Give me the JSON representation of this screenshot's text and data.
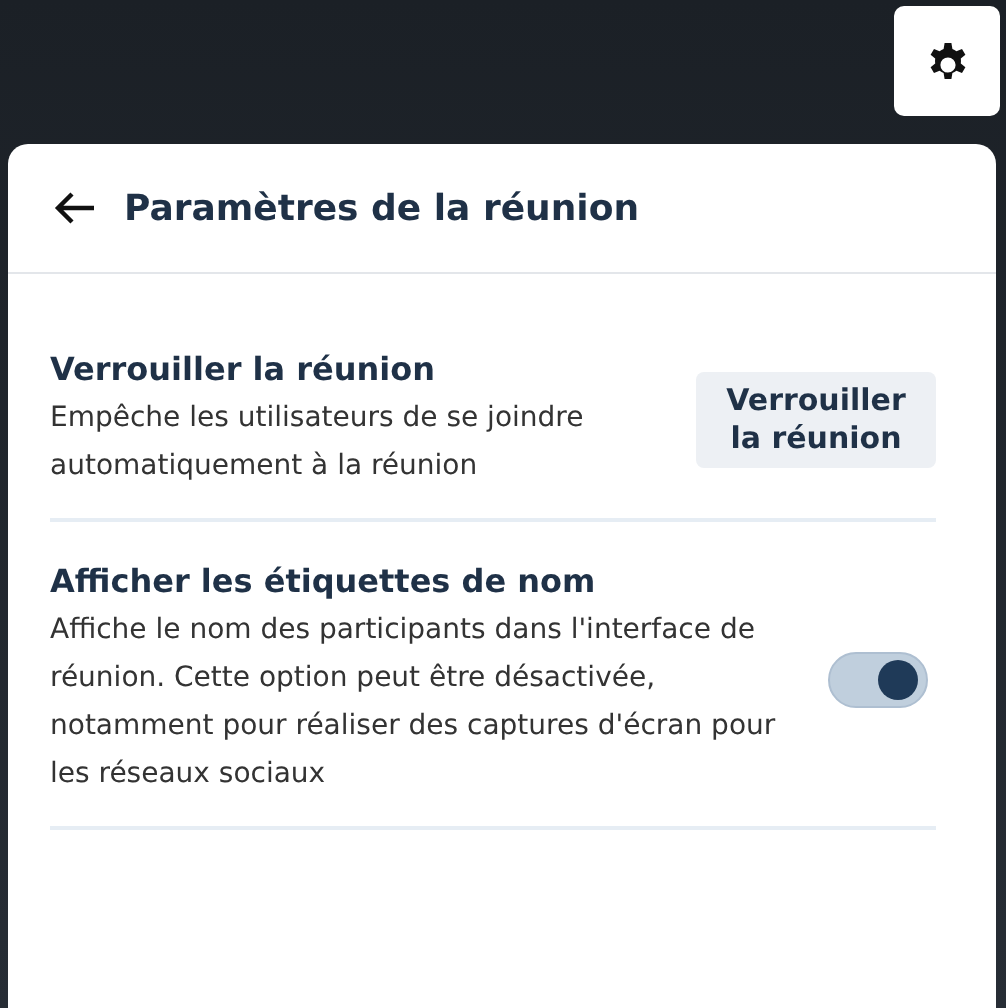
{
  "panel": {
    "title": "Paramètres de la réunion"
  },
  "settings": [
    {
      "kind": "button",
      "title": "Verrouiller la réunion",
      "description": "Empêche les utilisateurs de se joindre automatiquement à la réunion",
      "button": "Verrouiller la réunion"
    },
    {
      "kind": "toggle",
      "title": "Afficher les étiquettes de nom",
      "description": "Affiche le nom des participants dans l'interface de réunion. Cette option peut être désactivée, notamment pour réaliser des captures d'écran pour les réseaux sociaux",
      "on": true
    }
  ]
}
